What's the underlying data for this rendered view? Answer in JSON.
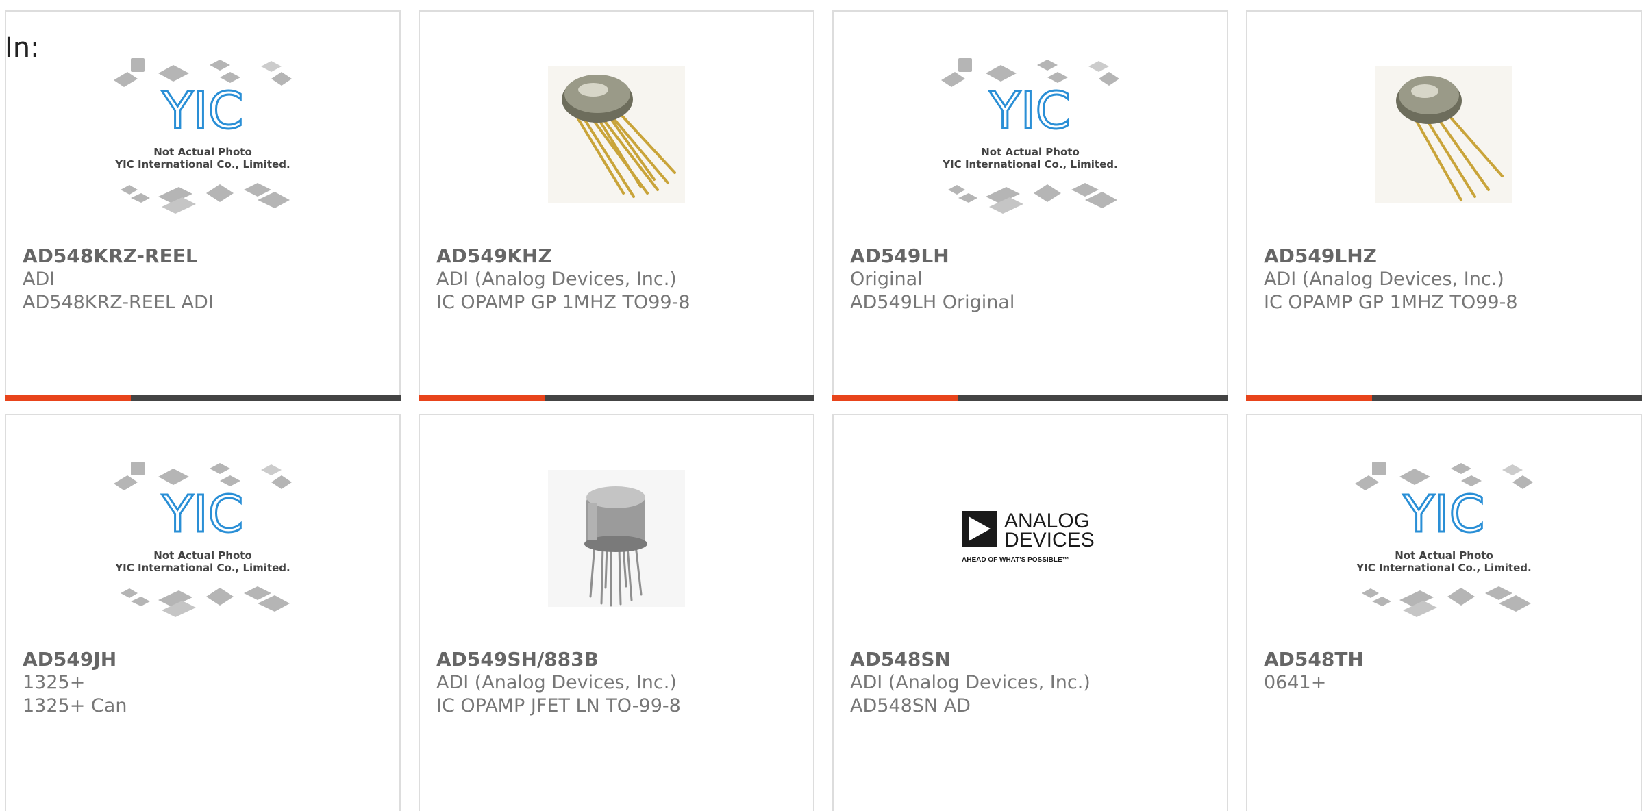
{
  "filter": {
    "label": "In:"
  },
  "placeholder_caption": {
    "line1": "Not Actual Photo",
    "line2": "YIC International Co., Limited.",
    "logo_text": "YIC"
  },
  "brand_logo": {
    "line1": "ANALOG",
    "line2": "DEVICES",
    "tagline": "AHEAD OF WHAT'S POSSIBLE™"
  },
  "colors": {
    "accent": "#e8441b",
    "bar": "#444444",
    "border": "#dddddd",
    "text": "#666666"
  },
  "products": [
    {
      "part_number": "AD548KRZ-REEL",
      "manufacturer": "ADI",
      "description": "AD548KRZ-REEL ADI",
      "image": "yic-placeholder"
    },
    {
      "part_number": "AD549KHZ",
      "manufacturer": "ADI (Analog Devices, Inc.)",
      "description": "IC OPAMP GP 1MHZ TO99-8",
      "image": "to99-gold-can"
    },
    {
      "part_number": "AD549LH",
      "manufacturer": "Original",
      "description": "AD549LH Original",
      "image": "yic-placeholder"
    },
    {
      "part_number": "AD549LHZ",
      "manufacturer": "ADI (Analog Devices, Inc.)",
      "description": "IC OPAMP GP 1MHZ TO99-8",
      "image": "to99-gold-can"
    },
    {
      "part_number": "AD549JH",
      "manufacturer": "1325+",
      "description": "1325+ Can",
      "image": "yic-placeholder"
    },
    {
      "part_number": "AD549SH/883B",
      "manufacturer": "ADI (Analog Devices, Inc.)",
      "description": "IC OPAMP JFET LN TO-99-8",
      "image": "to99-metal-can"
    },
    {
      "part_number": "AD548SN",
      "manufacturer": "ADI (Analog Devices, Inc.)",
      "description": "AD548SN AD",
      "image": "analog-devices-logo"
    },
    {
      "part_number": "AD548TH",
      "manufacturer": "0641+",
      "description": "",
      "image": "yic-placeholder"
    }
  ]
}
